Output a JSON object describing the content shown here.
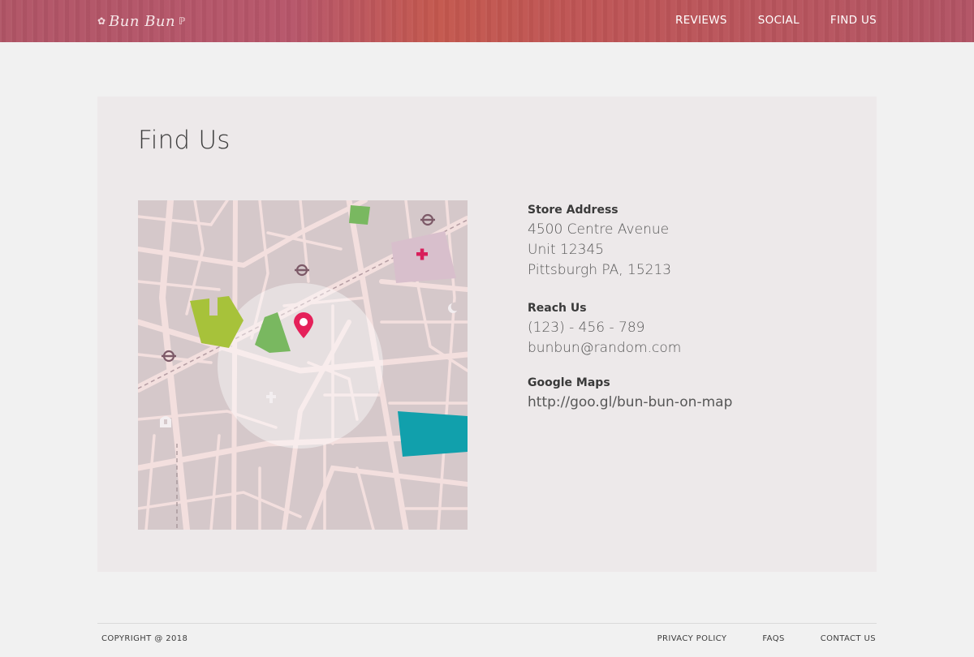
{
  "header": {
    "logo_text": "Bun Bun",
    "nav": [
      {
        "label": "REVIEWS"
      },
      {
        "label": "SOCIAL"
      },
      {
        "label": "FIND US"
      }
    ]
  },
  "main": {
    "title": "Find Us",
    "store_address": {
      "label": "Store Address",
      "lines": [
        "4500 Centre Avenue",
        "Unit 12345",
        "Pittsburgh PA, 15213"
      ]
    },
    "reach_us": {
      "label": "Reach Us",
      "phone": "(123) - 456 - 789",
      "email": "bunbun@random.com"
    },
    "google_maps": {
      "label": "Google Maps",
      "link": "http://goo.gl/bun-bun-on-map"
    },
    "map": {
      "colors": {
        "background": "#d5c8ca",
        "roads": "#f3dfde",
        "park_green": "#79b860",
        "park_lime": "#a7c23a",
        "water": "#11a0ac",
        "hospital": "#d8bfcc",
        "pin": "#e5215a",
        "metro": "#7d5a68"
      }
    }
  },
  "footer": {
    "copyright": "COPYRIGHT @ 2018",
    "links": [
      {
        "label": "PRIVACY POLICY"
      },
      {
        "label": "FAQS"
      },
      {
        "label": "CONTACT US"
      }
    ]
  }
}
